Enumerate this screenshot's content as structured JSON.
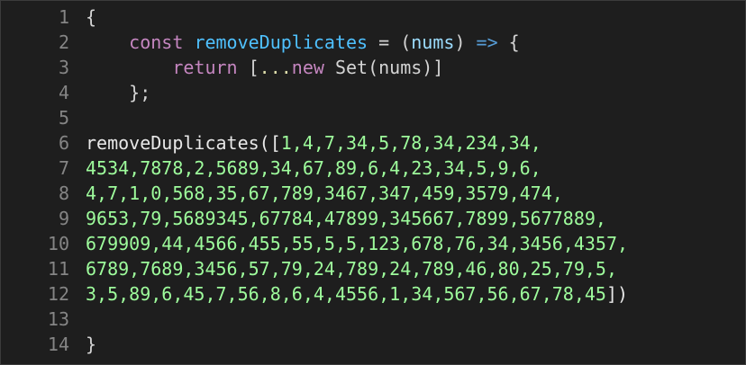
{
  "editor": {
    "lines": [
      {
        "n": "1",
        "tokens": [
          {
            "t": "{",
            "c": "t-plain"
          }
        ]
      },
      {
        "n": "2",
        "tokens": [
          {
            "t": "    ",
            "c": "t-plain"
          },
          {
            "t": "const",
            "c": "t-kw"
          },
          {
            "t": " ",
            "c": "t-plain"
          },
          {
            "t": "removeDuplicates",
            "c": "t-fnname"
          },
          {
            "t": " = ",
            "c": "t-op"
          },
          {
            "t": "(",
            "c": "t-plain"
          },
          {
            "t": "nums",
            "c": "t-var"
          },
          {
            "t": ")",
            "c": "t-plain"
          },
          {
            "t": " => ",
            "c": "t-kw2"
          },
          {
            "t": "{",
            "c": "t-plain"
          }
        ]
      },
      {
        "n": "3",
        "tokens": [
          {
            "t": "        ",
            "c": "t-plain"
          },
          {
            "t": "return",
            "c": "t-kw"
          },
          {
            "t": " [",
            "c": "t-plain"
          },
          {
            "t": "...",
            "c": "t-spread"
          },
          {
            "t": "new",
            "c": "t-kw"
          },
          {
            "t": " Set(nums)]",
            "c": "t-plain"
          }
        ]
      },
      {
        "n": "4",
        "tokens": [
          {
            "t": "    };",
            "c": "t-plain"
          }
        ]
      },
      {
        "n": "5",
        "tokens": []
      },
      {
        "n": "6",
        "tokens": [
          {
            "t": "removeDuplicates([",
            "c": "t-call"
          },
          {
            "t": "1,4,7,34,5,78,34,234,34,",
            "c": "t-bright"
          }
        ]
      },
      {
        "n": "7",
        "tokens": [
          {
            "t": "4534,7878,2,5689,34,67,89,6,4,23,34,5,9,6,",
            "c": "t-bright"
          }
        ]
      },
      {
        "n": "8",
        "tokens": [
          {
            "t": "4,7,1,0,568,35,67,789,3467,347,459,3579,474,",
            "c": "t-bright"
          }
        ]
      },
      {
        "n": "9",
        "tokens": [
          {
            "t": "9653,79,5689345,67784,47899,345667,7899,5677889,",
            "c": "t-bright"
          }
        ]
      },
      {
        "n": "10",
        "tokens": [
          {
            "t": "679909,44,4566,455,55,5,5,123,678,76,34,3456,4357,",
            "c": "t-bright"
          }
        ]
      },
      {
        "n": "11",
        "tokens": [
          {
            "t": "6789,7689,3456,57,79,24,789,24,789,46,80,25,79,5,",
            "c": "t-bright"
          }
        ]
      },
      {
        "n": "12",
        "tokens": [
          {
            "t": "3,5,89,6,45,7,56,8,6,4,4556,1,34,567,56,67,78,45",
            "c": "t-bright"
          },
          {
            "t": "])",
            "c": "t-call"
          }
        ]
      },
      {
        "n": "13",
        "tokens": []
      },
      {
        "n": "14",
        "tokens": [
          {
            "t": "}",
            "c": "t-plain"
          }
        ]
      }
    ]
  }
}
